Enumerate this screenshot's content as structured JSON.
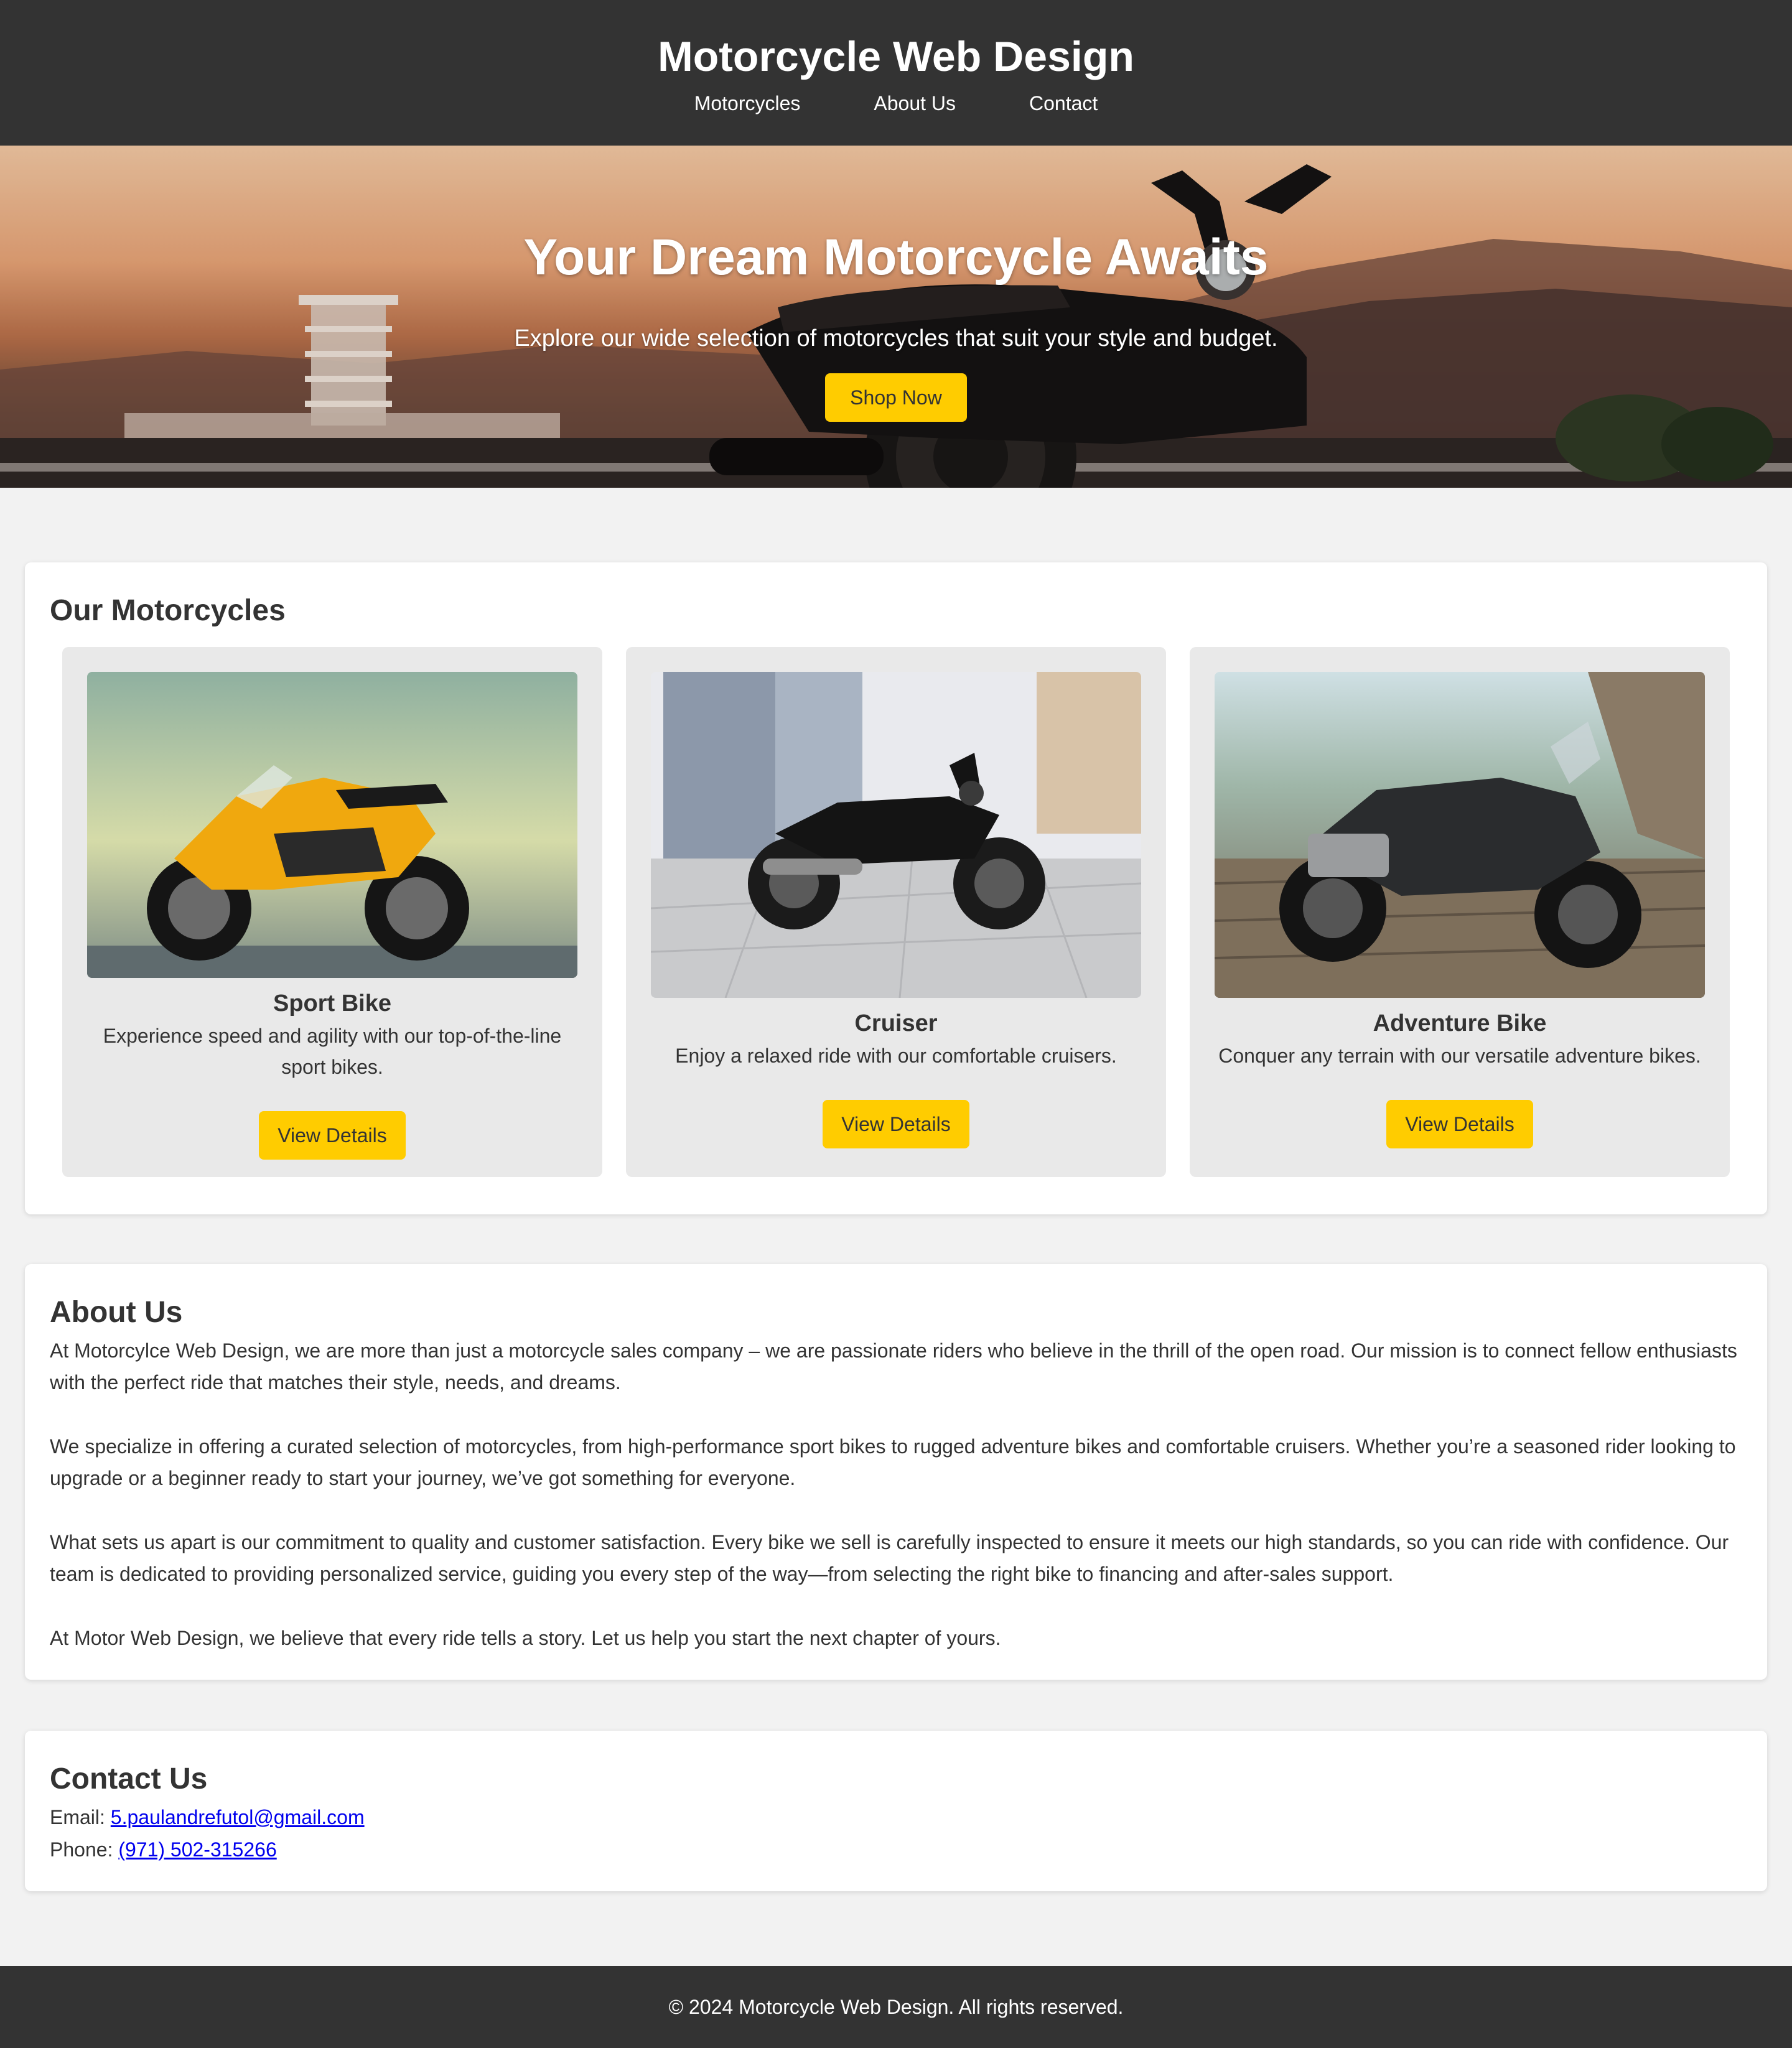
{
  "header": {
    "title": "Motorcycle Web Design",
    "nav": [
      "Motorcycles",
      "About Us",
      "Contact"
    ]
  },
  "hero": {
    "heading": "Your Dream Motorcycle Awaits",
    "subheading": "Explore our wide selection of motorcycles that suit your style and budget.",
    "button": "Shop Now"
  },
  "motorcycles": {
    "title": "Our Motorcycles",
    "items": [
      {
        "name": "Sport Bike",
        "description": "Experience speed and agility with our top-of-the-line sport bikes.",
        "button": "View Details"
      },
      {
        "name": "Cruiser",
        "description": "Enjoy a relaxed ride with our comfortable cruisers.",
        "button": "View Details"
      },
      {
        "name": "Adventure Bike",
        "description": "Conquer any terrain with our versatile adventure bikes.",
        "button": "View Details"
      }
    ]
  },
  "about": {
    "title": "About Us",
    "paragraphs": [
      "At Motorcylce Web Design, we are more than just a motorcycle sales company – we are passionate riders who believe in the thrill of the open road. Our mission is to connect fellow enthusiasts with the perfect ride that matches their style, needs, and dreams.",
      "We specialize in offering a curated selection of motorcycles, from high-performance sport bikes to rugged adventure bikes and comfortable cruisers. Whether you’re a seasoned rider looking to upgrade or a beginner ready to start your journey, we’ve got something for everyone.",
      "What sets us apart is our commitment to quality and customer satisfaction. Every bike we sell is carefully inspected to ensure it meets our high standards, so you can ride with confidence. Our team is dedicated to providing personalized service, guiding you every step of the way—from selecting the right bike to financing and after-sales support.",
      "At Motor Web Design, we believe that every ride tells a story. Let us help you start the next chapter of yours."
    ]
  },
  "contact": {
    "title": "Contact Us",
    "email_label": "Email:",
    "email": "5.paulandrefutol@gmail.com",
    "phone_label": "Phone:",
    "phone": "(971) 502-315266"
  },
  "footer": {
    "text": "© 2024 Motorcycle Web Design. All rights reserved."
  },
  "colors": {
    "header_bg": "#333333",
    "accent": "#ffcc00",
    "page_bg": "#f2f2f2",
    "card_bg": "#ffffff",
    "bike_card_bg": "#e9e9e9",
    "link": "#0000ee"
  }
}
